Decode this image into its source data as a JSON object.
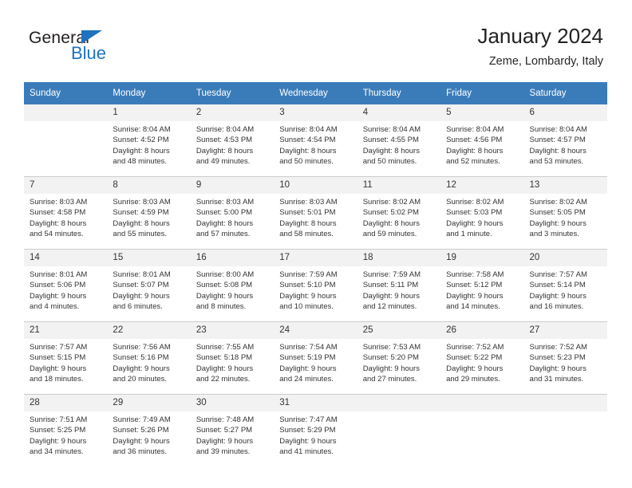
{
  "brand": {
    "name_top": "General",
    "name_bottom": "Blue",
    "triangle_color": "#1f72bd"
  },
  "header": {
    "title": "January 2024",
    "subtitle": "Zeme, Lombardy, Italy"
  },
  "theme": {
    "header_row_color": "#3a7cba",
    "daynum_band_color": "#f2f2f2",
    "grid_line_color": "#cccccc",
    "text_color": "#333333"
  },
  "weekdays": [
    "Sunday",
    "Monday",
    "Tuesday",
    "Wednesday",
    "Thursday",
    "Friday",
    "Saturday"
  ],
  "labels": {
    "sunrise_prefix": "Sunrise:",
    "sunset_prefix": "Sunset:",
    "daylight_prefix": "Daylight:"
  },
  "weeks": [
    [
      {
        "day": "",
        "lines": []
      },
      {
        "day": "1",
        "lines": [
          "Sunrise: 8:04 AM",
          "Sunset: 4:52 PM",
          "Daylight: 8 hours",
          "and 48 minutes."
        ]
      },
      {
        "day": "2",
        "lines": [
          "Sunrise: 8:04 AM",
          "Sunset: 4:53 PM",
          "Daylight: 8 hours",
          "and 49 minutes."
        ]
      },
      {
        "day": "3",
        "lines": [
          "Sunrise: 8:04 AM",
          "Sunset: 4:54 PM",
          "Daylight: 8 hours",
          "and 50 minutes."
        ]
      },
      {
        "day": "4",
        "lines": [
          "Sunrise: 8:04 AM",
          "Sunset: 4:55 PM",
          "Daylight: 8 hours",
          "and 50 minutes."
        ]
      },
      {
        "day": "5",
        "lines": [
          "Sunrise: 8:04 AM",
          "Sunset: 4:56 PM",
          "Daylight: 8 hours",
          "and 52 minutes."
        ]
      },
      {
        "day": "6",
        "lines": [
          "Sunrise: 8:04 AM",
          "Sunset: 4:57 PM",
          "Daylight: 8 hours",
          "and 53 minutes."
        ]
      }
    ],
    [
      {
        "day": "7",
        "lines": [
          "Sunrise: 8:03 AM",
          "Sunset: 4:58 PM",
          "Daylight: 8 hours",
          "and 54 minutes."
        ]
      },
      {
        "day": "8",
        "lines": [
          "Sunrise: 8:03 AM",
          "Sunset: 4:59 PM",
          "Daylight: 8 hours",
          "and 55 minutes."
        ]
      },
      {
        "day": "9",
        "lines": [
          "Sunrise: 8:03 AM",
          "Sunset: 5:00 PM",
          "Daylight: 8 hours",
          "and 57 minutes."
        ]
      },
      {
        "day": "10",
        "lines": [
          "Sunrise: 8:03 AM",
          "Sunset: 5:01 PM",
          "Daylight: 8 hours",
          "and 58 minutes."
        ]
      },
      {
        "day": "11",
        "lines": [
          "Sunrise: 8:02 AM",
          "Sunset: 5:02 PM",
          "Daylight: 8 hours",
          "and 59 minutes."
        ]
      },
      {
        "day": "12",
        "lines": [
          "Sunrise: 8:02 AM",
          "Sunset: 5:03 PM",
          "Daylight: 9 hours",
          "and 1 minute."
        ]
      },
      {
        "day": "13",
        "lines": [
          "Sunrise: 8:02 AM",
          "Sunset: 5:05 PM",
          "Daylight: 9 hours",
          "and 3 minutes."
        ]
      }
    ],
    [
      {
        "day": "14",
        "lines": [
          "Sunrise: 8:01 AM",
          "Sunset: 5:06 PM",
          "Daylight: 9 hours",
          "and 4 minutes."
        ]
      },
      {
        "day": "15",
        "lines": [
          "Sunrise: 8:01 AM",
          "Sunset: 5:07 PM",
          "Daylight: 9 hours",
          "and 6 minutes."
        ]
      },
      {
        "day": "16",
        "lines": [
          "Sunrise: 8:00 AM",
          "Sunset: 5:08 PM",
          "Daylight: 9 hours",
          "and 8 minutes."
        ]
      },
      {
        "day": "17",
        "lines": [
          "Sunrise: 7:59 AM",
          "Sunset: 5:10 PM",
          "Daylight: 9 hours",
          "and 10 minutes."
        ]
      },
      {
        "day": "18",
        "lines": [
          "Sunrise: 7:59 AM",
          "Sunset: 5:11 PM",
          "Daylight: 9 hours",
          "and 12 minutes."
        ]
      },
      {
        "day": "19",
        "lines": [
          "Sunrise: 7:58 AM",
          "Sunset: 5:12 PM",
          "Daylight: 9 hours",
          "and 14 minutes."
        ]
      },
      {
        "day": "20",
        "lines": [
          "Sunrise: 7:57 AM",
          "Sunset: 5:14 PM",
          "Daylight: 9 hours",
          "and 16 minutes."
        ]
      }
    ],
    [
      {
        "day": "21",
        "lines": [
          "Sunrise: 7:57 AM",
          "Sunset: 5:15 PM",
          "Daylight: 9 hours",
          "and 18 minutes."
        ]
      },
      {
        "day": "22",
        "lines": [
          "Sunrise: 7:56 AM",
          "Sunset: 5:16 PM",
          "Daylight: 9 hours",
          "and 20 minutes."
        ]
      },
      {
        "day": "23",
        "lines": [
          "Sunrise: 7:55 AM",
          "Sunset: 5:18 PM",
          "Daylight: 9 hours",
          "and 22 minutes."
        ]
      },
      {
        "day": "24",
        "lines": [
          "Sunrise: 7:54 AM",
          "Sunset: 5:19 PM",
          "Daylight: 9 hours",
          "and 24 minutes."
        ]
      },
      {
        "day": "25",
        "lines": [
          "Sunrise: 7:53 AM",
          "Sunset: 5:20 PM",
          "Daylight: 9 hours",
          "and 27 minutes."
        ]
      },
      {
        "day": "26",
        "lines": [
          "Sunrise: 7:52 AM",
          "Sunset: 5:22 PM",
          "Daylight: 9 hours",
          "and 29 minutes."
        ]
      },
      {
        "day": "27",
        "lines": [
          "Sunrise: 7:52 AM",
          "Sunset: 5:23 PM",
          "Daylight: 9 hours",
          "and 31 minutes."
        ]
      }
    ],
    [
      {
        "day": "28",
        "lines": [
          "Sunrise: 7:51 AM",
          "Sunset: 5:25 PM",
          "Daylight: 9 hours",
          "and 34 minutes."
        ]
      },
      {
        "day": "29",
        "lines": [
          "Sunrise: 7:49 AM",
          "Sunset: 5:26 PM",
          "Daylight: 9 hours",
          "and 36 minutes."
        ]
      },
      {
        "day": "30",
        "lines": [
          "Sunrise: 7:48 AM",
          "Sunset: 5:27 PM",
          "Daylight: 9 hours",
          "and 39 minutes."
        ]
      },
      {
        "day": "31",
        "lines": [
          "Sunrise: 7:47 AM",
          "Sunset: 5:29 PM",
          "Daylight: 9 hours",
          "and 41 minutes."
        ]
      },
      {
        "day": "",
        "lines": []
      },
      {
        "day": "",
        "lines": []
      },
      {
        "day": "",
        "lines": []
      }
    ]
  ]
}
